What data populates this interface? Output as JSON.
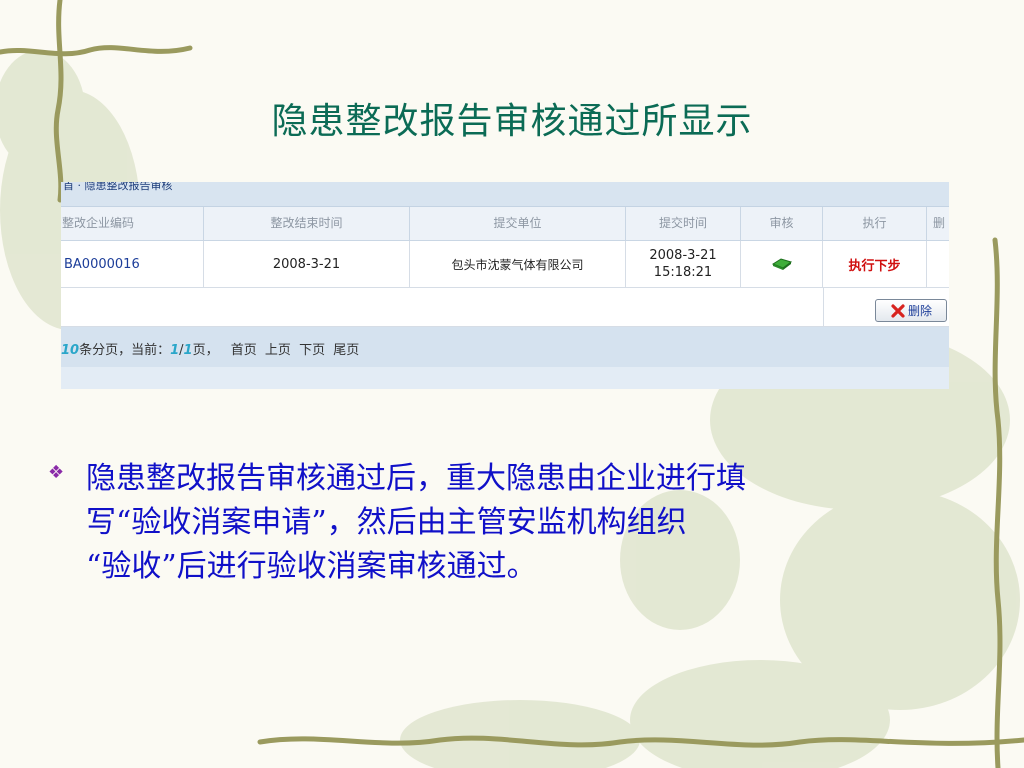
{
  "slide": {
    "title": "隐患整改报告审核通过所显示"
  },
  "screenshot": {
    "breadcrumb": "首 · 隐患整改报告审核",
    "columns": [
      "整改企业编码",
      "整改结束时间",
      "提交单位",
      "提交时间",
      "审核",
      "执行",
      "删"
    ],
    "row": {
      "code": "BA0000016",
      "end_date": "2008-3-21",
      "unit": "包头市沈蒙气体有限公司",
      "submit_date": "2008-3-21",
      "submit_time": "15:18:21",
      "audit_icon": "approved-icon",
      "exec": "执行下步"
    },
    "delete_label": "删除",
    "pager": {
      "per_page": "10",
      "text1": "条分页，当前：",
      "current": "1",
      "slash": "/",
      "total": "1",
      "text2": "页，",
      "first": "首页",
      "prev": "上页",
      "next": "下页",
      "last": "尾页"
    }
  },
  "bullet": {
    "marker": "❖",
    "line1": "隐患整改报告审核通过后，重大隐患由企业进行填",
    "line2": "写“验收消案申请”，然后由主管安监机构组织",
    "line3": "“验收”后进行验收消案审核通过。"
  },
  "colors": {
    "title": "#0b6b55",
    "body_text": "#1010c8",
    "bullet": "#8a2aa8",
    "exec_red": "#d01010"
  }
}
